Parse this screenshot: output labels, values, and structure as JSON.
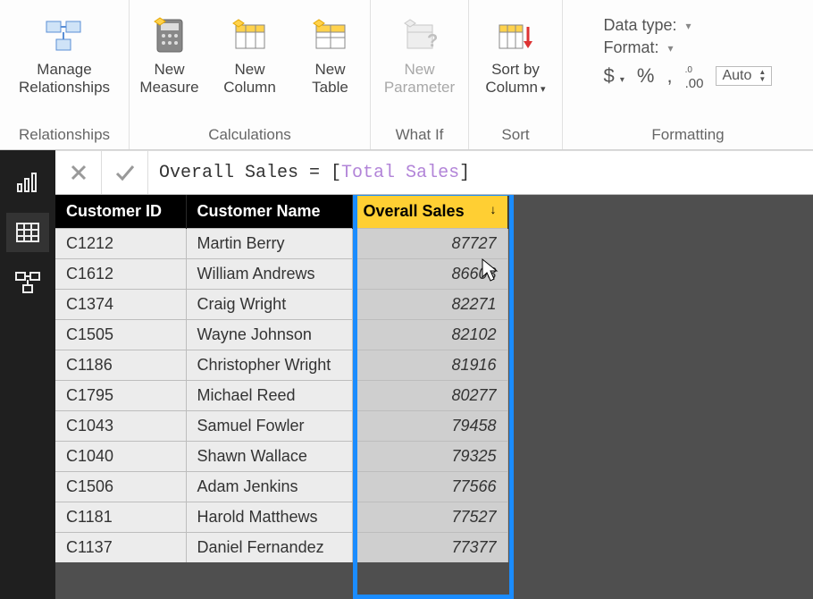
{
  "ribbon": {
    "groups": {
      "relationships": {
        "label": "Relationships",
        "manage": "Manage\nRelationships"
      },
      "calculations": {
        "label": "Calculations",
        "measure": "New\nMeasure",
        "column": "New\nColumn",
        "table": "New\nTable"
      },
      "whatif": {
        "label": "What If",
        "parameter": "New\nParameter"
      },
      "sort": {
        "label": "Sort",
        "sortby": "Sort by\nColumn"
      },
      "formatting": {
        "label": "Formatting",
        "datatype_lbl": "Data type:",
        "format_lbl": "Format:",
        "dollar": "$",
        "percent": "%",
        "comma": ",",
        "decimals": ".00",
        "auto": "Auto"
      }
    }
  },
  "formula": {
    "prefix": "Overall Sales = ",
    "open": "[",
    "ref": "Total Sales",
    "close": "]"
  },
  "table": {
    "headers": {
      "id": "Customer ID",
      "name": "Customer Name",
      "sales": "Overall Sales"
    },
    "rows": [
      {
        "id": "C1212",
        "name": "Martin Berry",
        "sales": "87727"
      },
      {
        "id": "C1612",
        "name": "William Andrews",
        "sales": "86603"
      },
      {
        "id": "C1374",
        "name": "Craig Wright",
        "sales": "82271"
      },
      {
        "id": "C1505",
        "name": "Wayne Johnson",
        "sales": "82102"
      },
      {
        "id": "C1186",
        "name": "Christopher Wright",
        "sales": "81916"
      },
      {
        "id": "C1795",
        "name": "Michael Reed",
        "sales": "80277"
      },
      {
        "id": "C1043",
        "name": "Samuel Fowler",
        "sales": "79458"
      },
      {
        "id": "C1040",
        "name": "Shawn Wallace",
        "sales": "79325"
      },
      {
        "id": "C1506",
        "name": "Adam Jenkins",
        "sales": "77566"
      },
      {
        "id": "C1181",
        "name": "Harold Matthews",
        "sales": "77527"
      },
      {
        "id": "C1137",
        "name": "Daniel Fernandez",
        "sales": "77377"
      }
    ]
  }
}
